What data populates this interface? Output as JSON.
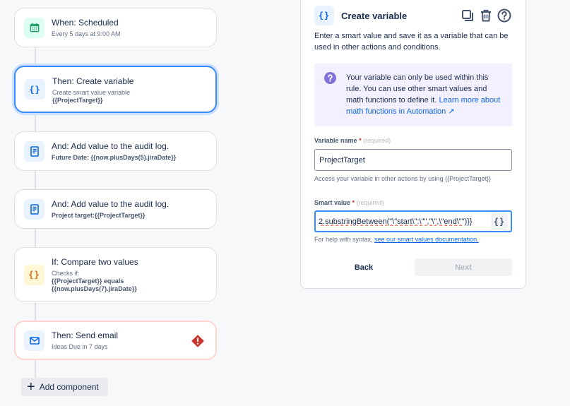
{
  "flow": {
    "cards": [
      {
        "title": "When: Scheduled",
        "subtitle": "Every 5 days at 9:00 AM",
        "icon": "calendar-icon"
      },
      {
        "title": "Then: Create variable",
        "subtitle": "Create smart value variable",
        "detail": "{{ProjectTarget}}",
        "icon": "braces-icon",
        "selected": true
      },
      {
        "title": "And: Add value to the audit log.",
        "subtitle": "Future Date: {{now.plusDays(5).jiraDate}}",
        "icon": "document-icon"
      },
      {
        "title": "And: Add value to the audit log.",
        "subtitle": "Project target:{{ProjectTarget}}",
        "icon": "document-icon"
      },
      {
        "title": "If: Compare two values",
        "subtitle": "Checks if:",
        "detail": "{{ProjectTarget}} equals",
        "detail2": "{{now.plusDays(7).jiraDate}}",
        "icon": "braces-icon"
      },
      {
        "title": "Then: Send email",
        "subtitle": "Ideas Due in 7 days",
        "icon": "mail-icon",
        "error": true
      }
    ],
    "add_component_label": "Add component"
  },
  "panel": {
    "title": "Create variable",
    "description": "Enter a smart value and save it as a variable that can be used in other actions and conditions.",
    "info": {
      "text": "Your variable can only be used within this rule. You can use other smart values and math functions to define it.",
      "link": "Learn more about math functions in Automation ↗"
    },
    "variable_name": {
      "label": "Variable name",
      "required_mark": "*",
      "required_hint": "(required)",
      "value": "ProjectTarget",
      "help": "Access your variable in other actions by using {{ProjectTarget}}"
    },
    "smart_value": {
      "label": "Smart value",
      "required_mark": "*",
      "required_hint": "(required)",
      "value": "2.substringBetween(\"\\\"start\\\":\\\"\",\"\\\",\\\"end\\\"\")}}",
      "help_prefix": "For help with syntax,",
      "help_link": "see our smart values documentation."
    },
    "buttons": {
      "back": "Back",
      "next": "Next"
    }
  },
  "colors": {
    "accent": "#0c66e4",
    "selected_border": "#388bff",
    "error": "#c9372c",
    "info_bg": "#f3f0ff",
    "info_icon": "#8270db"
  }
}
